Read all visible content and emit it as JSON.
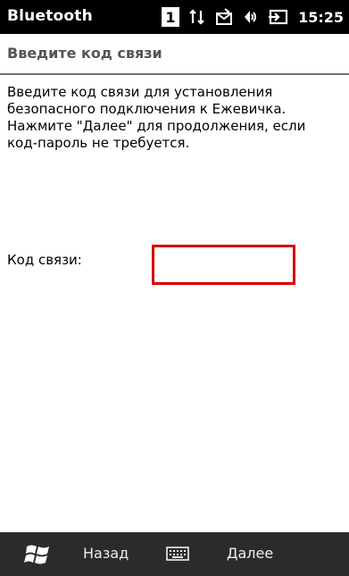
{
  "statusbar": {
    "app_title": "Bluetooth",
    "sim_number": "1",
    "time": "15:25",
    "icons": [
      "sim-1-icon",
      "data-connection-icon",
      "sms-icon",
      "volume-icon",
      "battery-charging-icon"
    ]
  },
  "header": {
    "title": "Введите код связи"
  },
  "content": {
    "instructions": "Введите код связи для установления безопасного подключения к Ежевичка. Нажмите \"Далее\" для продолжения, если код-пароль не требуется.",
    "passcode_label": "Код связи:",
    "passcode_value": ""
  },
  "menubar": {
    "left_softkey": "Назад",
    "right_softkey": "Далее",
    "icons": [
      "windows-start-icon",
      "keyboard-icon"
    ]
  },
  "colors": {
    "statusbar_bg": "#000000",
    "menubar_bg": "#2b2b2b",
    "focus_border": "#d30000",
    "header_text": "#555555"
  }
}
